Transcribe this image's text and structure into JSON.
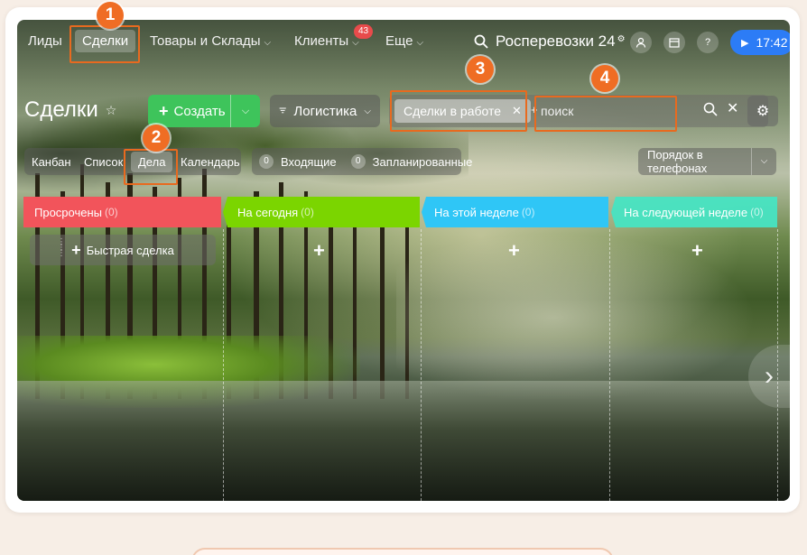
{
  "topnav": {
    "items": [
      {
        "label": "Лиды"
      },
      {
        "label": "Сделки"
      },
      {
        "label": "Товары и Склады"
      },
      {
        "label": "Клиенты"
      },
      {
        "label": "Еще"
      }
    ],
    "clients_badge": "43",
    "brand": "Росперевозки 24",
    "time": "17:42"
  },
  "toolbar": {
    "title": "Сделки",
    "create_label": "Создать",
    "logistics_label": "Логистика",
    "filter_chip": "Сделки в работе",
    "search_placeholder": "поиск"
  },
  "view_tabs": [
    {
      "label": "Канбан"
    },
    {
      "label": "Список"
    },
    {
      "label": "Дела"
    },
    {
      "label": "Календарь"
    }
  ],
  "counters": [
    {
      "count": "0",
      "label": "Входящие"
    },
    {
      "count": "0",
      "label": "Запланированные"
    }
  ],
  "order_label": "Порядок в телефонах",
  "columns": [
    {
      "title": "Просрочены",
      "count": "(0)",
      "color": "#f2545b"
    },
    {
      "title": "На сегодня",
      "count": "(0)",
      "color": "#7bd500"
    },
    {
      "title": "На этой неделе",
      "count": "(0)",
      "color": "#2fc6f6"
    },
    {
      "title": "На следующей неделе",
      "count": "(0)",
      "color": "#47e4c2"
    }
  ],
  "quick_deal_label": "Быстрая сделка",
  "annotations": [
    "1",
    "2",
    "3",
    "4"
  ],
  "colors": {
    "accent": "#ef6d24",
    "create": "#3ec45b",
    "time_button": "#2c7cf6"
  }
}
